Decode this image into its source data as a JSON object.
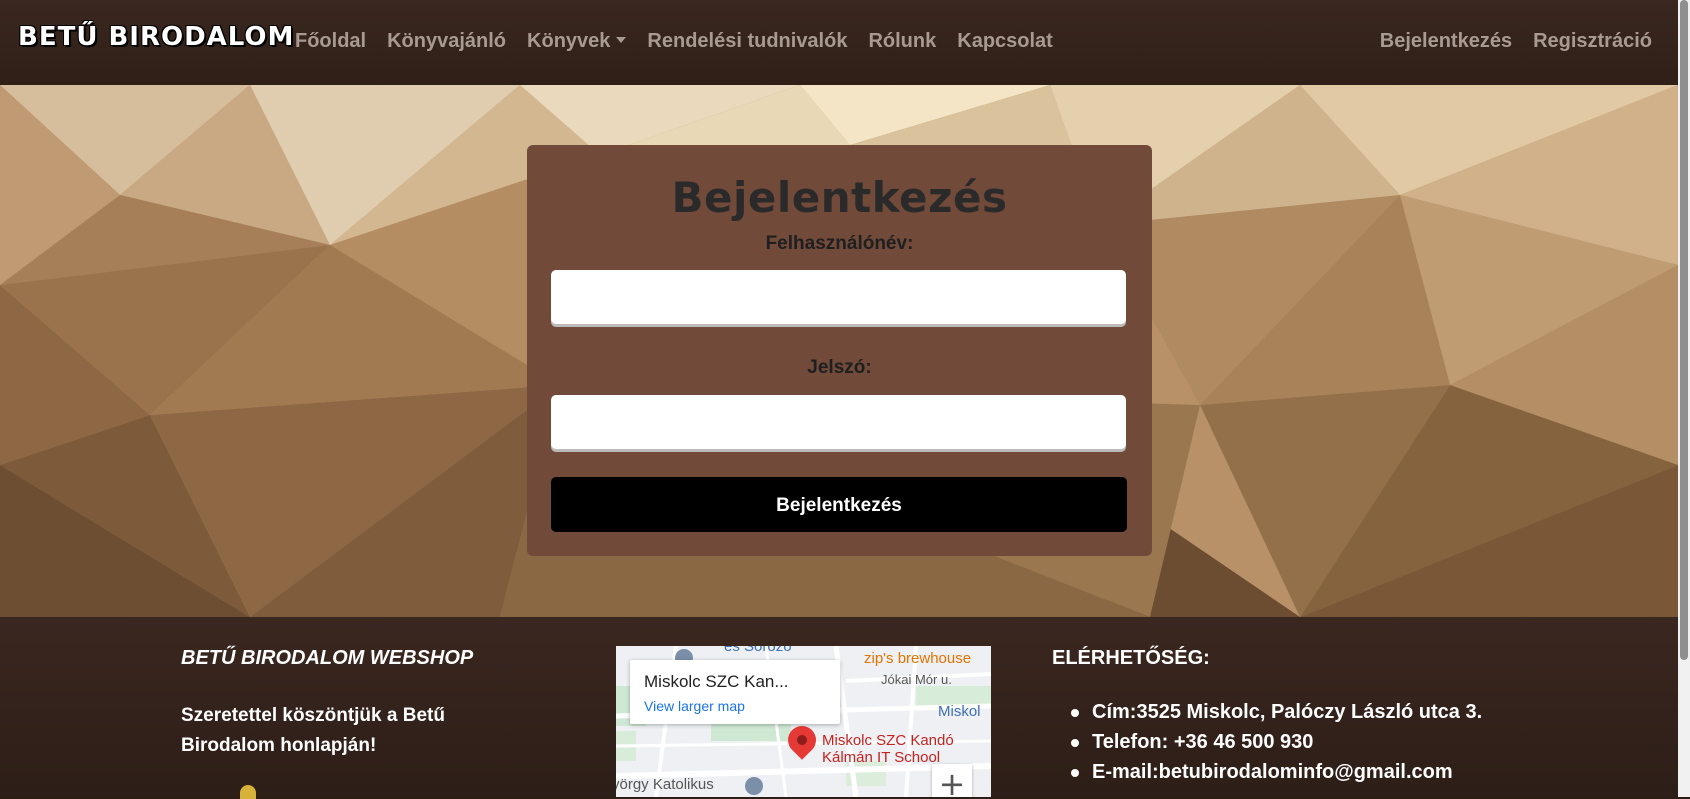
{
  "navbar": {
    "brand": "BETŰ BIRODALOM",
    "links": [
      "Főoldal",
      "Könyvajánló",
      "Könyvek",
      "Rendelési tudnivalók",
      "Rólunk",
      "Kapcsolat"
    ],
    "right_links": [
      "Bejelentkezés",
      "Regisztráció"
    ]
  },
  "login": {
    "title": "Bejelentkezés",
    "username_label": "Felhasználónév:",
    "password_label": "Jelszó:",
    "username_value": "",
    "password_value": "",
    "submit_label": "Bejelentkezés"
  },
  "footer": {
    "title": "BETŰ BIRODALOM WEBSHOP",
    "welcome": "Szeretettel köszöntjük a Betű Birodalom honlapján!",
    "map": {
      "place_name": "Miskolc SZC Kan...",
      "larger_map_link": "View larger map",
      "marker_label_line1": "Miskolc SZC Kandó",
      "marker_label_line2": "Kálmán IT School",
      "labels": [
        "és Söröző",
        "zip's brewhouse",
        "Jókai Mór u.",
        "Miskol",
        "yörgy Katolikus"
      ],
      "zoom_in": "+"
    },
    "contact_title": "ELÉRHETŐSÉG:",
    "contact_items": [
      "Cím:3525 Miskolc, Palóczy László utca 3.",
      "Telefon: +36 46 500 930",
      "E-mail:betubirodalominfo@gmail.com"
    ]
  },
  "colors": {
    "navbar_bg": "#3a2820",
    "card_bg": "#714a3a",
    "button_bg": "#000000",
    "nav_link": "#a89a92"
  }
}
